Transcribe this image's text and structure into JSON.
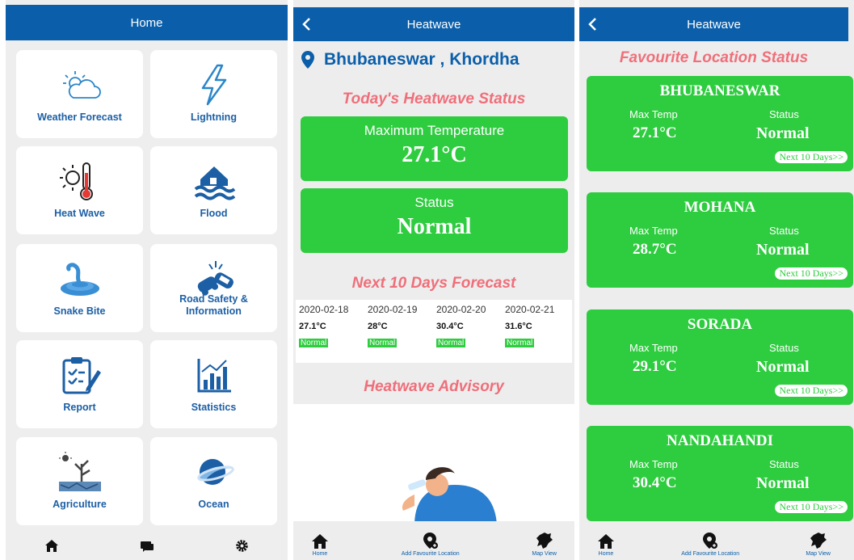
{
  "home": {
    "title": "Home",
    "tiles": [
      {
        "label": "Weather Forecast",
        "icon": "weather-icon"
      },
      {
        "label": "Lightning",
        "icon": "lightning-icon"
      },
      {
        "label": "Heat Wave",
        "icon": "thermometer-sun-icon"
      },
      {
        "label": "Flood",
        "icon": "flood-icon"
      },
      {
        "label": "Snake Bite",
        "icon": "snake-icon"
      },
      {
        "label": "Road Safety &",
        "label2": "Information",
        "icon": "road-safety-icon"
      },
      {
        "label": "Report",
        "icon": "clipboard-icon"
      },
      {
        "label": "Statistics",
        "icon": "chart-icon"
      },
      {
        "label": "Agriculture",
        "icon": "agriculture-icon"
      },
      {
        "label": "Ocean",
        "icon": "ocean-icon"
      }
    ],
    "bottom_icons": [
      "home-icon",
      "chat-icon",
      "gear-icon"
    ]
  },
  "heatwave": {
    "title": "Heatwave",
    "location": "Bhubaneswar , Khordha",
    "today_title": "Today's Heatwave Status",
    "max_temp_label": "Maximum Temperature",
    "max_temp_value": "27.1°C",
    "status_label": "Status",
    "status_value": "Normal",
    "forecast_title": "Next 10 Days Forecast",
    "forecast": [
      {
        "date": "2020-02-18",
        "temp": "27.1°C",
        "status": "Normal"
      },
      {
        "date": "2020-02-19",
        "temp": "28°C",
        "status": "Normal"
      },
      {
        "date": "2020-02-20",
        "temp": "30.4°C",
        "status": "Normal"
      },
      {
        "date": "2020-02-21",
        "temp": "31.6°C",
        "status": "Normal"
      }
    ],
    "advisory_title": "Heatwave Advisory",
    "nav": {
      "home": "Home",
      "add": "Add Favourite Location",
      "map": "Map View"
    }
  },
  "favourites": {
    "title": "Heatwave",
    "heading": "Favourite Location Status",
    "max_temp_label": "Max Temp",
    "status_label": "Status",
    "next_label": "Next 10 Days>>",
    "cards": [
      {
        "name": "BHUBANESWAR",
        "temp": "27.1°C",
        "status": "Normal"
      },
      {
        "name": "MOHANA",
        "temp": "28.7°C",
        "status": "Normal"
      },
      {
        "name": "SORADA",
        "temp": "29.1°C",
        "status": "Normal"
      },
      {
        "name": "NANDAHANDI",
        "temp": "30.4°C",
        "status": "Normal"
      }
    ],
    "nav": {
      "home": "Home",
      "add": "Add Favourite Location",
      "map": "Map View"
    }
  },
  "colors": {
    "appbar": "#0b5faa",
    "green": "#2ecc3f",
    "accent_title": "#ef6f7a",
    "tile_label": "#1c5fa5"
  }
}
